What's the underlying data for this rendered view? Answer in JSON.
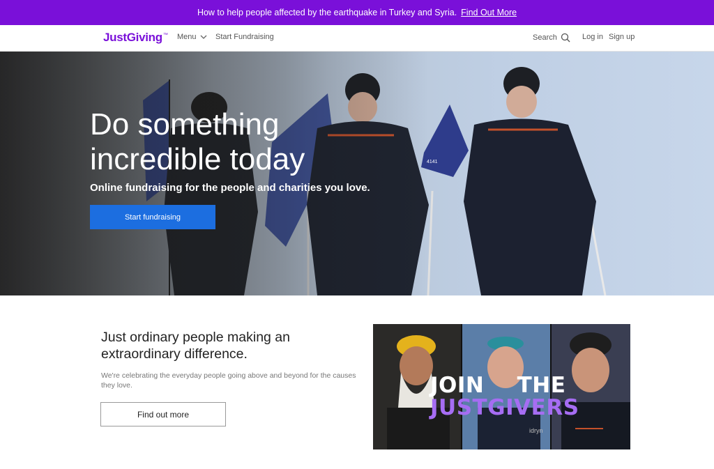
{
  "banner": {
    "text": "How to help people affected by the earthquake in Turkey and Syria.",
    "link": "Find Out More"
  },
  "nav": {
    "logo": "JustGiving",
    "logo_mark": "™",
    "menu": "Menu",
    "start_fundraising": "Start Fundraising",
    "search": "Search",
    "login": "Log in",
    "signup": "Sign up"
  },
  "hero": {
    "title": "Do something incredible today",
    "subtitle": "Online fundraising for the people and charities you love.",
    "button": "Start fundraising",
    "flag_text": "4141"
  },
  "promo": {
    "heading": "Just ordinary people making an extraordinary difference.",
    "text": "We're celebrating the everyday people going above and beyond for the causes they love.",
    "button": "Find out more",
    "overlay_line1": "JOIN THE",
    "overlay_line2": "JUSTGIVERS",
    "watermark": "idryn"
  },
  "colors": {
    "brand_purple": "#7a10d9",
    "primary_blue": "#1c6ee0",
    "overlay_purple": "#a66df3"
  },
  "icons": {
    "menu": "chevron-down-icon",
    "search": "search-icon"
  }
}
